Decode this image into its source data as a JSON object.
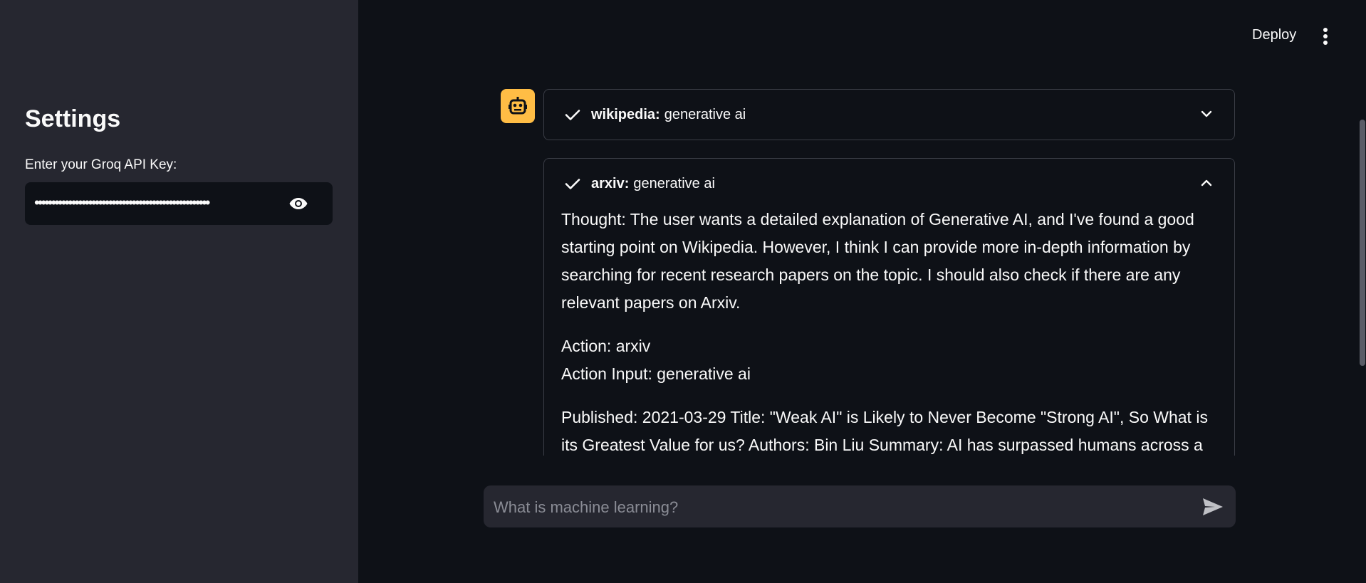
{
  "sidebar": {
    "title": "Settings",
    "api_key_label": "Enter your Groq API Key:",
    "api_key_masked": "••••••••••••••••••••••••••••••••••••••••••••••••••••"
  },
  "header": {
    "deploy_label": "Deploy"
  },
  "chat": {
    "expanders": [
      {
        "tool": "wikipedia:",
        "query": "generative ai",
        "expanded": false
      },
      {
        "tool": "arxiv:",
        "query": "generative ai",
        "expanded": true,
        "thought": "Thought: The user wants a detailed explanation of Generative AI, and I've found a good starting point on Wikipedia. However, I think I can provide more in-depth information by searching for recent research papers on the topic. I should also check if there are any relevant papers on Arxiv.",
        "action": "Action: arxiv",
        "action_input": "Action Input: generative ai",
        "result": "Published: 2021-03-29 Title: \"Weak AI\" is Likely to Never Become \"Strong AI\", So What is its Greatest Value for us? Authors: Bin Liu Summary: AI has surpassed humans across a variety"
      }
    ],
    "input_placeholder": "What is machine learning?"
  },
  "colors": {
    "sidebar_bg": "#262730",
    "main_bg": "#0e1117",
    "avatar_bg": "#ffbd45"
  }
}
